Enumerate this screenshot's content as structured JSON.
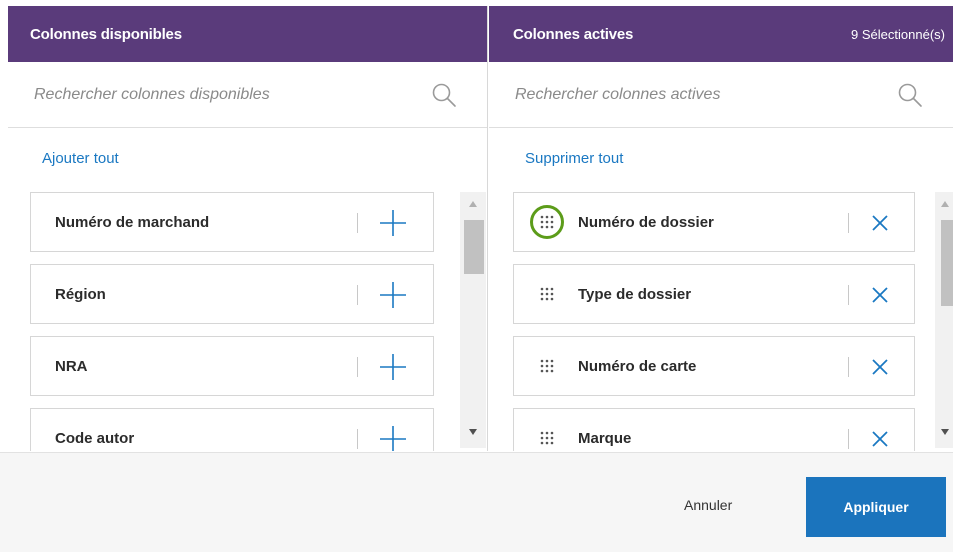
{
  "available": {
    "title": "Colonnes disponibles",
    "search_placeholder": "Rechercher colonnes disponibles",
    "add_all_label": "Ajouter tout",
    "items": [
      {
        "label": "Numéro de marchand"
      },
      {
        "label": "Région"
      },
      {
        "label": "NRA"
      },
      {
        "label": "Code autor"
      }
    ]
  },
  "active": {
    "title": "Colonnes actives",
    "selected_count": "9 Sélectionné(s)",
    "search_placeholder": "Rechercher colonnes actives",
    "remove_all_label": "Supprimer tout",
    "items": [
      {
        "label": "Numéro de dossier"
      },
      {
        "label": "Type de dossier"
      },
      {
        "label": "Numéro de carte"
      },
      {
        "label": "Marque"
      }
    ]
  },
  "footer": {
    "cancel_label": "Annuler",
    "apply_label": "Appliquer"
  },
  "colors": {
    "header_bg": "#5a3b7b",
    "accent": "#1a78c2",
    "apply_bg": "#1b74bd",
    "highlight": "#5c9c1a"
  },
  "icons": {
    "search": "search-icon",
    "add": "plus-icon",
    "remove": "close-icon",
    "drag": "drag-handle-icon"
  }
}
